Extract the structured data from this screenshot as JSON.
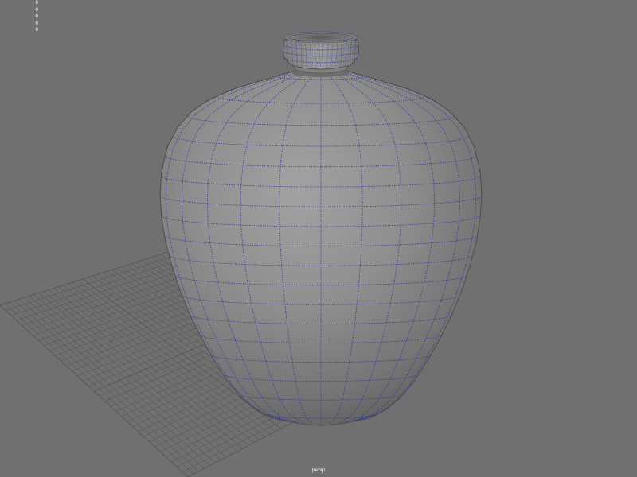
{
  "viewport": {
    "camera_label": "persp",
    "background_color": "#707070",
    "grid_color": "#595959",
    "mesh_color": "#888888",
    "wire_color": "#2a2f9a"
  },
  "hud": {
    "rows": [
      {
        "label": "",
        "value": "0"
      },
      {
        "label": "",
        "value": "0"
      },
      {
        "label": "",
        "value": "0"
      },
      {
        "label": "",
        "value": "0"
      },
      {
        "label": "",
        "value": "0"
      }
    ]
  },
  "scene": {
    "object": "vase",
    "object_icon": "polygon-mesh-icon",
    "display_mode": "wireframe-on-shaded",
    "ground_grid": true
  }
}
